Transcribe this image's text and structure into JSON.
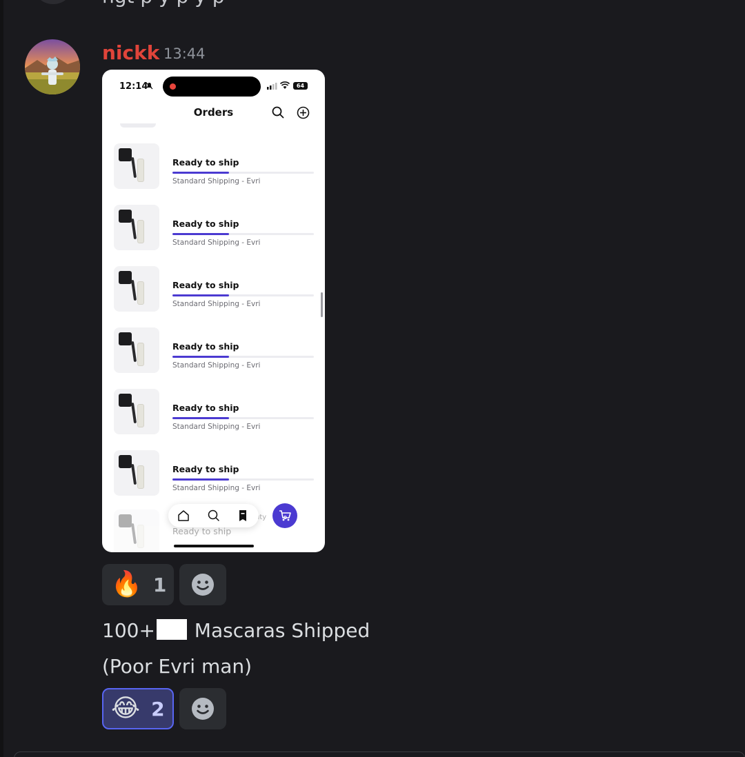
{
  "chat": {
    "previous_message_fragment": "ngt                                p       y                      p    y             p",
    "message": {
      "author": "nickk",
      "timestamp": "13:44",
      "author_color": "#e0443a"
    }
  },
  "screenshot": {
    "status_bar": {
      "time": "12:14",
      "battery": "64"
    },
    "title": "Orders",
    "orders": [
      {
        "status": "Ready to ship",
        "shipping": "Standard Shipping - Evri",
        "progress": 0.4
      },
      {
        "status": "Ready to ship",
        "shipping": "Standard Shipping - Evri",
        "progress": 0.4
      },
      {
        "status": "Ready to ship",
        "shipping": "Standard Shipping - Evri",
        "progress": 0.4
      },
      {
        "status": "Ready to ship",
        "shipping": "Standard Shipping - Evri",
        "progress": 0.4
      },
      {
        "status": "Ready to ship",
        "shipping": "Standard Shipping - Evri",
        "progress": 0.4
      },
      {
        "status": "Ready to ship",
        "shipping": "Standard Shipping - Evri",
        "progress": 0.4
      }
    ],
    "ghost_order": {
      "status": "Ready to ship",
      "extra": "uty"
    },
    "cart_count": "0",
    "accent_color": "#4b3ad1"
  },
  "reactions_1": [
    {
      "emoji": "🔥",
      "count": "1",
      "active": false
    }
  ],
  "text": {
    "line1_before": "100+",
    "line1_after": " Mascaras Shipped",
    "line2": "(Poor Evri man)"
  },
  "reactions_2": [
    {
      "emoji": "😂",
      "count": "2",
      "active": true
    }
  ],
  "icons": {
    "avatar": "rick-sanchez-avatar",
    "add_reaction": "smiley-face-icon"
  }
}
